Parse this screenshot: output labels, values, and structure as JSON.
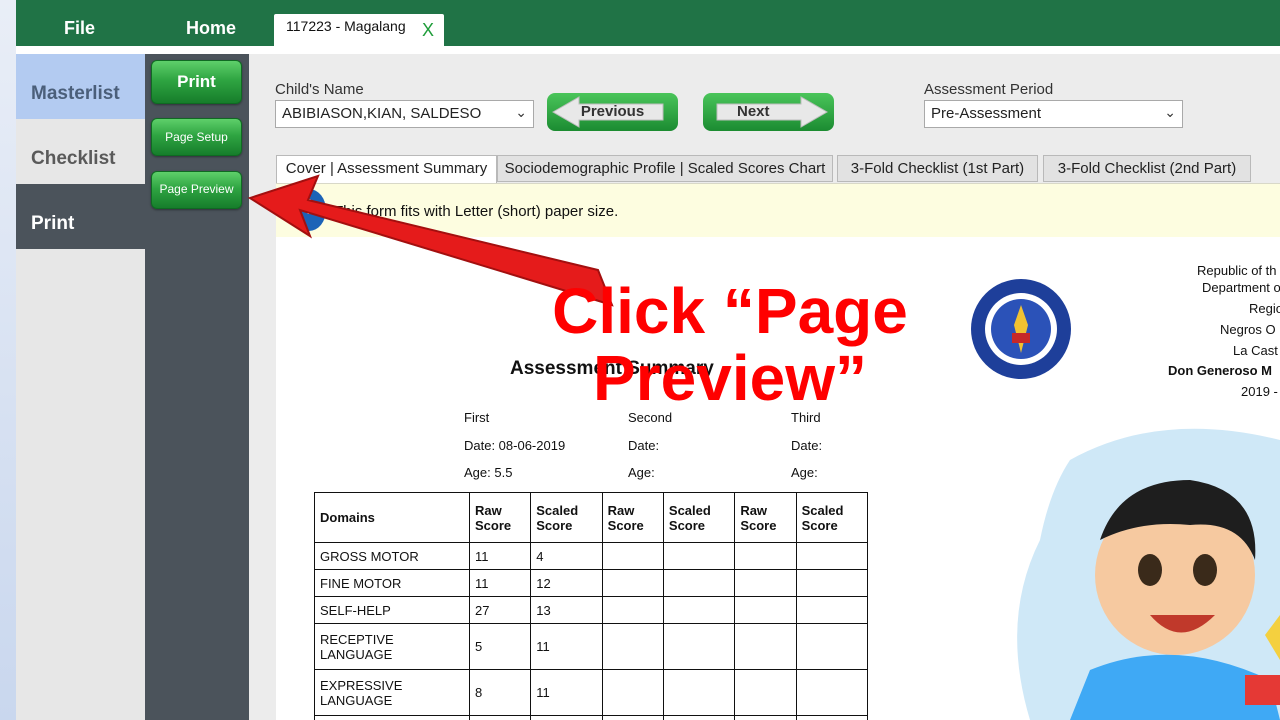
{
  "ribbon": {
    "file_label": "File",
    "home_label": "Home",
    "doc_tab": "117223 -  Magalang",
    "doc_close": "X"
  },
  "nav": {
    "masterlist": "Masterlist",
    "checklist": "Checklist",
    "print": "Print"
  },
  "commands": {
    "print": "Print",
    "page_setup": "Page Setup",
    "page_preview": "Page Preview"
  },
  "child": {
    "label": "Child's Name",
    "value": "ABIBIASON,KIAN, SALDESO"
  },
  "assessment": {
    "label": "Assessment Period",
    "value": "Pre-Assessment"
  },
  "nav_buttons": {
    "previous": "Previous",
    "next": "Next"
  },
  "form_tabs": [
    {
      "label": "Cover | Assessment Summary"
    },
    {
      "label": "Sociodemographic Profile | Scaled Scores Chart"
    },
    {
      "label": "3-Fold Checklist (1st Part)"
    },
    {
      "label": "3-Fold Checklist (2nd Part)"
    }
  ],
  "info": {
    "message": "This form fits with Letter (short) paper size.",
    "icon": "info-icon"
  },
  "document": {
    "header": [
      "Republic of th",
      "Department o",
      "Regio",
      "Negros O",
      "La Cast",
      "Don Generoso M",
      "2019 -"
    ],
    "title": "Assessment Summary",
    "periods": [
      {
        "name": "First",
        "date": "Date: 08-06-2019",
        "age": "Age: 5.5"
      },
      {
        "name": "Second",
        "date": "Date:",
        "age": "Age:"
      },
      {
        "name": "Third",
        "date": "Date:",
        "age": "Age:"
      }
    ],
    "table": {
      "headers": [
        "Domains",
        "Raw Score",
        "Scaled Score",
        "Raw Score",
        "Scaled Score",
        "Raw Score",
        "Scaled Score"
      ],
      "rows": [
        [
          "GROSS MOTOR",
          "11",
          "4",
          "",
          "",
          "",
          ""
        ],
        [
          "FINE MOTOR",
          "11",
          "12",
          "",
          "",
          "",
          ""
        ],
        [
          "SELF-HELP",
          "27",
          "13",
          "",
          "",
          "",
          ""
        ],
        [
          "RECEPTIVE LANGUAGE",
          "5",
          "11",
          "",
          "",
          "",
          ""
        ],
        [
          "EXPRESSIVE LANGUAGE",
          "8",
          "11",
          "",
          "",
          "",
          ""
        ]
      ]
    }
  },
  "annotation": {
    "text": "Click “Page Preview”",
    "color": "#ff0000"
  },
  "colors": {
    "ribbon": "#207346",
    "accent_green": "#2fa542",
    "nav_dark": "#4b535b"
  }
}
